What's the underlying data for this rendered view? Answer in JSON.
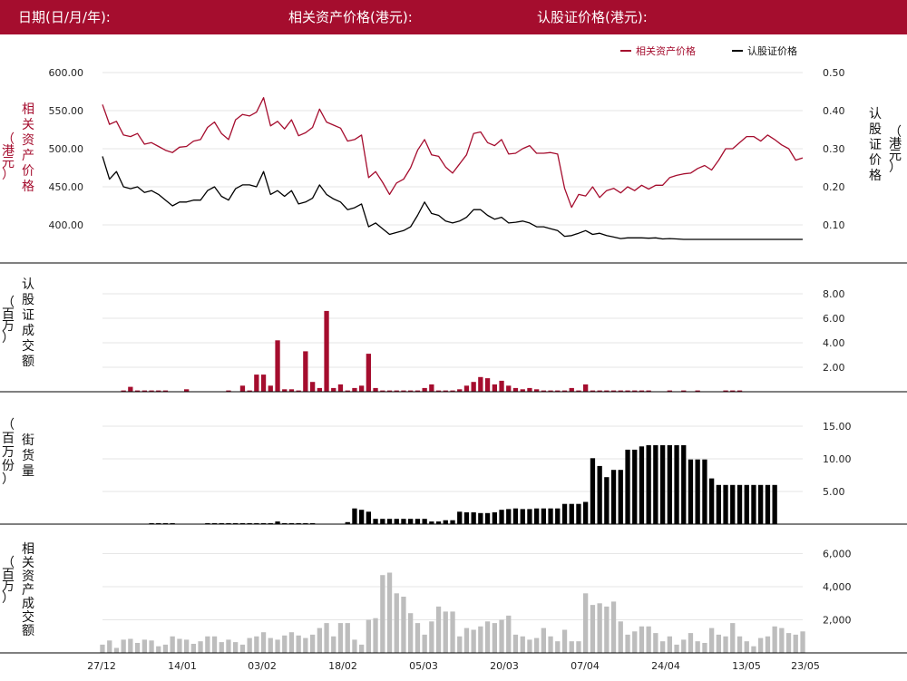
{
  "header": {
    "date_label": "日期(日/月/年):",
    "underlying_label": "相关资产价格(港元):",
    "warrant_label": "认股证价格(港元):"
  },
  "colors": {
    "header_bg": "#a50d2e",
    "underlying": "#a50d2e",
    "warrant": "#000000",
    "turnover_bar": "#a50d2e",
    "outstanding_bar": "#000000",
    "underlying_turnover_bar": "#bdbdbd",
    "grid": "#e6e6e6"
  },
  "chart_data": [
    {
      "type": "line",
      "legend": [
        "相关资产价格",
        "认股证价格"
      ],
      "legend_position": "top-right",
      "y_left_label": "相关资产价格（港元）",
      "y_right_label": "认股证价格（港元）",
      "y_left_ticks": [
        "400.00",
        "450.00",
        "500.00",
        "550.00",
        "600.00"
      ],
      "y_right_ticks": [
        "0.10",
        "0.20",
        "0.30",
        "0.40",
        "0.50"
      ],
      "y_left_range": [
        350,
        610
      ],
      "y_right_range": [
        0,
        0.52
      ],
      "series": [
        {
          "name": "相关资产价格",
          "axis": "left",
          "values": [
            558,
            532,
            536,
            518,
            516,
            520,
            506,
            508,
            503,
            498,
            495,
            502,
            503,
            510,
            512,
            528,
            535,
            520,
            512,
            538,
            545,
            543,
            548,
            567,
            530,
            536,
            526,
            538,
            517,
            521,
            528,
            552,
            535,
            531,
            527,
            510,
            512,
            518,
            462,
            470,
            456,
            440,
            455,
            460,
            475,
            498,
            512,
            492,
            490,
            476,
            468,
            480,
            492,
            520,
            522,
            508,
            504,
            512,
            493,
            494,
            500,
            504,
            494,
            494,
            495,
            493,
            448,
            423,
            440,
            438,
            450,
            436,
            445,
            448,
            442,
            450,
            445,
            452,
            447,
            452,
            452,
            462,
            465,
            467,
            468,
            474,
            478,
            472,
            485,
            500,
            500,
            508,
            516,
            516,
            510,
            518,
            512,
            505,
            500,
            485,
            488
          ]
        },
        {
          "name": "认股证价格",
          "axis": "right",
          "values": [
            0.28,
            0.22,
            0.24,
            0.2,
            0.195,
            0.2,
            0.185,
            0.19,
            0.18,
            0.165,
            0.15,
            0.16,
            0.16,
            0.165,
            0.165,
            0.19,
            0.2,
            0.175,
            0.165,
            0.195,
            0.205,
            0.205,
            0.2,
            0.24,
            0.18,
            0.19,
            0.175,
            0.19,
            0.155,
            0.16,
            0.17,
            0.205,
            0.18,
            0.168,
            0.16,
            0.14,
            0.145,
            0.155,
            0.095,
            0.105,
            0.09,
            0.075,
            0.08,
            0.085,
            0.095,
            0.125,
            0.16,
            0.13,
            0.125,
            0.11,
            0.105,
            0.11,
            0.12,
            0.14,
            0.14,
            0.125,
            0.115,
            0.12,
            0.105,
            0.107,
            0.11,
            0.105,
            0.095,
            0.095,
            0.09,
            0.085,
            0.07,
            0.072,
            0.078,
            0.085,
            0.075,
            0.078,
            0.072,
            0.068,
            0.064,
            0.066,
            0.066,
            0.066,
            0.065,
            0.066,
            0.063,
            0.064,
            0.063,
            0.062,
            0.062,
            0.062,
            0.062,
            0.062,
            0.062,
            0.062,
            0.062,
            0.062,
            0.062,
            0.062,
            0.062,
            0.062,
            0.062,
            0.062,
            0.062,
            0.062,
            0.062
          ]
        }
      ]
    },
    {
      "type": "bar",
      "y_label": "认股证成交额（百万）",
      "y_ticks": [
        "2.00",
        "4.00",
        "6.00",
        "8.00"
      ],
      "y_range": [
        0,
        8.8
      ],
      "values": [
        0,
        0,
        0,
        0.1,
        0.4,
        0.1,
        0.1,
        0.1,
        0.1,
        0.1,
        0,
        0,
        0.2,
        0,
        0,
        0,
        0,
        0,
        0.1,
        0,
        0.5,
        0.1,
        1.4,
        1.4,
        0.5,
        4.2,
        0.2,
        0.2,
        0.1,
        3.3,
        0.8,
        0.3,
        6.6,
        0.3,
        0.6,
        0.1,
        0.3,
        0.5,
        3.1,
        0.3,
        0.1,
        0.1,
        0.1,
        0.1,
        0.1,
        0.1,
        0.3,
        0.6,
        0.1,
        0.1,
        0.1,
        0.2,
        0.5,
        0.8,
        1.2,
        1.1,
        0.6,
        0.9,
        0.5,
        0.3,
        0.2,
        0.3,
        0.2,
        0.1,
        0.1,
        0.1,
        0.1,
        0.3,
        0.1,
        0.6,
        0.1,
        0.1,
        0.1,
        0.1,
        0.1,
        0.1,
        0.1,
        0.1,
        0.1,
        0,
        0,
        0.1,
        0,
        0.1,
        0,
        0.1,
        0,
        0,
        0,
        0.1,
        0.1,
        0.1,
        0,
        0,
        0,
        0,
        0,
        0,
        0,
        0,
        0
      ]
    },
    {
      "type": "bar",
      "y_label": "街货量（百万份）",
      "y_ticks": [
        "5.00",
        "10.00",
        "15.00"
      ],
      "y_range": [
        0,
        15.5
      ],
      "values": [
        0,
        0,
        0,
        0,
        0,
        0,
        0,
        0.15,
        0.15,
        0.15,
        0.15,
        0,
        0,
        0,
        0,
        0.15,
        0.15,
        0.15,
        0.15,
        0.15,
        0.15,
        0.15,
        0.15,
        0.15,
        0.15,
        0.4,
        0.15,
        0.15,
        0.15,
        0.15,
        0.15,
        0,
        0,
        0,
        0,
        0.3,
        2.4,
        2.2,
        1.9,
        0.8,
        0.8,
        0.8,
        0.8,
        0.8,
        0.8,
        0.8,
        0.8,
        0.4,
        0.4,
        0.6,
        0.6,
        1.9,
        1.8,
        1.8,
        1.7,
        1.7,
        1.8,
        2.2,
        2.3,
        2.4,
        2.3,
        2.3,
        2.4,
        2.4,
        2.4,
        2.4,
        3.1,
        3.1,
        3.1,
        3.4,
        10.1,
        8.9,
        7.2,
        8.3,
        8.3,
        11.4,
        11.4,
        11.9,
        12.1,
        12.1,
        12.1,
        12.1,
        12.1,
        12.1,
        9.9,
        9.9,
        9.9,
        7.0,
        6.0,
        6.0,
        6.0,
        6.0,
        6.0,
        6.0,
        6.0,
        6.0,
        6.0,
        0,
        0,
        0,
        0
      ]
    },
    {
      "type": "bar",
      "y_label": "相关资产成交额（百万）",
      "y_ticks": [
        "2,000",
        "4,000",
        "6,000"
      ],
      "y_range": [
        0,
        6400
      ],
      "x_ticks": [
        "27/12",
        "14/01",
        "03/02",
        "18/02",
        "05/03",
        "20/03",
        "07/04",
        "24/04",
        "13/05",
        "23/05"
      ],
      "values": [
        500,
        750,
        300,
        800,
        850,
        600,
        800,
        750,
        400,
        500,
        1000,
        850,
        800,
        550,
        700,
        1000,
        1000,
        650,
        800,
        650,
        500,
        900,
        1000,
        1250,
        900,
        800,
        1050,
        1250,
        1050,
        900,
        1100,
        1500,
        1800,
        1000,
        1800,
        1800,
        800,
        500,
        2000,
        2100,
        4700,
        4850,
        3600,
        3400,
        2400,
        1800,
        1100,
        1900,
        2800,
        2500,
        2500,
        1000,
        1500,
        1400,
        1600,
        1900,
        1800,
        2000,
        2250,
        1100,
        1000,
        800,
        900,
        1500,
        1000,
        700,
        1400,
        700,
        700,
        3600,
        2900,
        3000,
        2800,
        3100,
        1900,
        1100,
        1300,
        1600,
        1600,
        1200,
        700,
        1000,
        500,
        800,
        1200,
        700,
        600,
        1500,
        1100,
        1000,
        1800,
        1000,
        700,
        400,
        900,
        1000,
        1600,
        1500,
        1200,
        1100,
        1300
      ]
    }
  ]
}
